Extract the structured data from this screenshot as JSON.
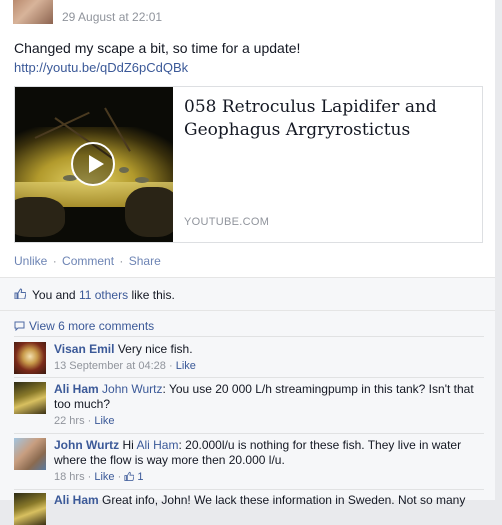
{
  "post": {
    "timestamp": "29 August at 22:01",
    "text": "Changed my scape a bit, so time for a update!",
    "link": "http://youtu.be/qDdZ6pCdQBk",
    "share": {
      "title": "058 Retroculus Lapidifer and Geophagus Argryrostictus",
      "source": "YOUTUBE.COM"
    },
    "actions": {
      "unlike": "Unlike",
      "comment": "Comment",
      "share": "Share",
      "separator": "·"
    }
  },
  "likes": {
    "prefix": "You and ",
    "others": "11 others",
    "suffix": " like this."
  },
  "comments_header": {
    "view_more": "View 6 more comments"
  },
  "comments": [
    {
      "author": "Visan Emil",
      "text": "Very nice fish.",
      "time": "13 September at 04:28",
      "like": "Like"
    },
    {
      "author": "Ali Ham",
      "mention": "John Wurtz",
      "text": ": You use 20 000 L/h streamingpump in this tank? Isn't that too much?",
      "time": "22 hrs",
      "like": "Like"
    },
    {
      "author": "John Wurtz",
      "prefix": "Hi ",
      "mention": "Ali Ham",
      "text": ": 20.000l/u is nothing for these fish. They live in water where the flow is way more then 20.000 l/u.",
      "time": "18 hrs",
      "like": "Like",
      "like_count": "1"
    },
    {
      "author": "Ali Ham",
      "text": "Great info, John! We lack these information in Sweden. Not so many"
    }
  ],
  "colors": {
    "link": "#3b5998",
    "muted": "#90949c",
    "ufi_bg": "#f6f7f9"
  }
}
